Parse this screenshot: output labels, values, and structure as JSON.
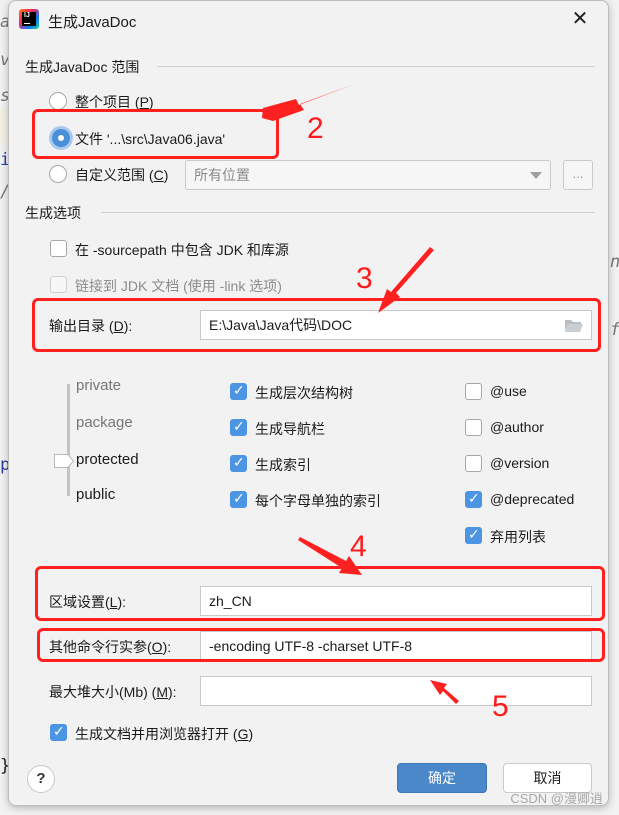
{
  "window": {
    "title": "生成JavaDoc",
    "close_icon": "close-icon",
    "app_icon": "intellij-idea-icon",
    "app_icon_text": "IJ"
  },
  "scope": {
    "section_title": "生成JavaDoc 范围",
    "options": [
      {
        "label": "整个项目 (",
        "mnemonic": "P",
        "suffix": ")",
        "selected": false
      },
      {
        "label": "文件 '...\\src\\Java06.java'",
        "mnemonic": "",
        "suffix": "",
        "selected": true
      },
      {
        "label": "自定义范围 (",
        "mnemonic": "C",
        "suffix": ")",
        "selected": false
      }
    ],
    "custom_scope_value": "所有位置",
    "more_button": "..."
  },
  "options": {
    "section_title": "生成选项",
    "include_jdk": {
      "label": "在 -sourcepath 中包含 JDK 和库源",
      "checked": false,
      "enabled": true
    },
    "link_jdk": {
      "label": "链接到 JDK 文档 (使用 -link 选项)",
      "checked": false,
      "enabled": false
    },
    "output_dir": {
      "label": "输出目录 (",
      "mnemonic": "D",
      "suffix": "):",
      "value": "E:\\Java\\Java代码\\DOC"
    },
    "visibility_levels": [
      "private",
      "package",
      "protected",
      "public"
    ],
    "visibility_selected": "protected",
    "generate_checks": [
      {
        "label": "生成层次结构树",
        "checked": true
      },
      {
        "label": "生成导航栏",
        "checked": true
      },
      {
        "label": "生成索引",
        "checked": true
      },
      {
        "label": "每个字母单独的索引",
        "checked": true
      }
    ],
    "tag_checks": [
      {
        "label": "@use",
        "checked": false
      },
      {
        "label": "@author",
        "checked": false
      },
      {
        "label": "@version",
        "checked": false
      },
      {
        "label": "@deprecated",
        "checked": true
      },
      {
        "label": "弃用列表",
        "checked": true
      }
    ],
    "locale": {
      "label": "区域设置(",
      "mnemonic": "L",
      "suffix": "):",
      "value": "zh_CN"
    },
    "other_args": {
      "label": "其他命令行实参(",
      "mnemonic": "O",
      "suffix": "):",
      "value": "-encoding UTF-8 -charset UTF-8"
    },
    "max_heap": {
      "label": "最大堆大小(Mb) (",
      "mnemonic": "M",
      "suffix": "):",
      "value": ""
    },
    "open_browser": {
      "label": "生成文档并用浏览器打开 (",
      "mnemonic": "G",
      "suffix": ")",
      "checked": true
    }
  },
  "buttons": {
    "help": "?",
    "ok": "确定",
    "cancel": "取消"
  },
  "annotations": {
    "numbers": [
      "2",
      "3",
      "4",
      "5"
    ],
    "color": "#ff1a1a"
  },
  "background_fragments": [
    "a",
    "v",
    "s",
    "i",
    "/",
    "p",
    "}",
    "n",
    "f"
  ],
  "watermark": "CSDN @漫卿逍",
  "colors": {
    "accent": "#4a88c9",
    "checkbox_on": "#4b95e3",
    "dialog_bg": "#f2f2f2"
  }
}
